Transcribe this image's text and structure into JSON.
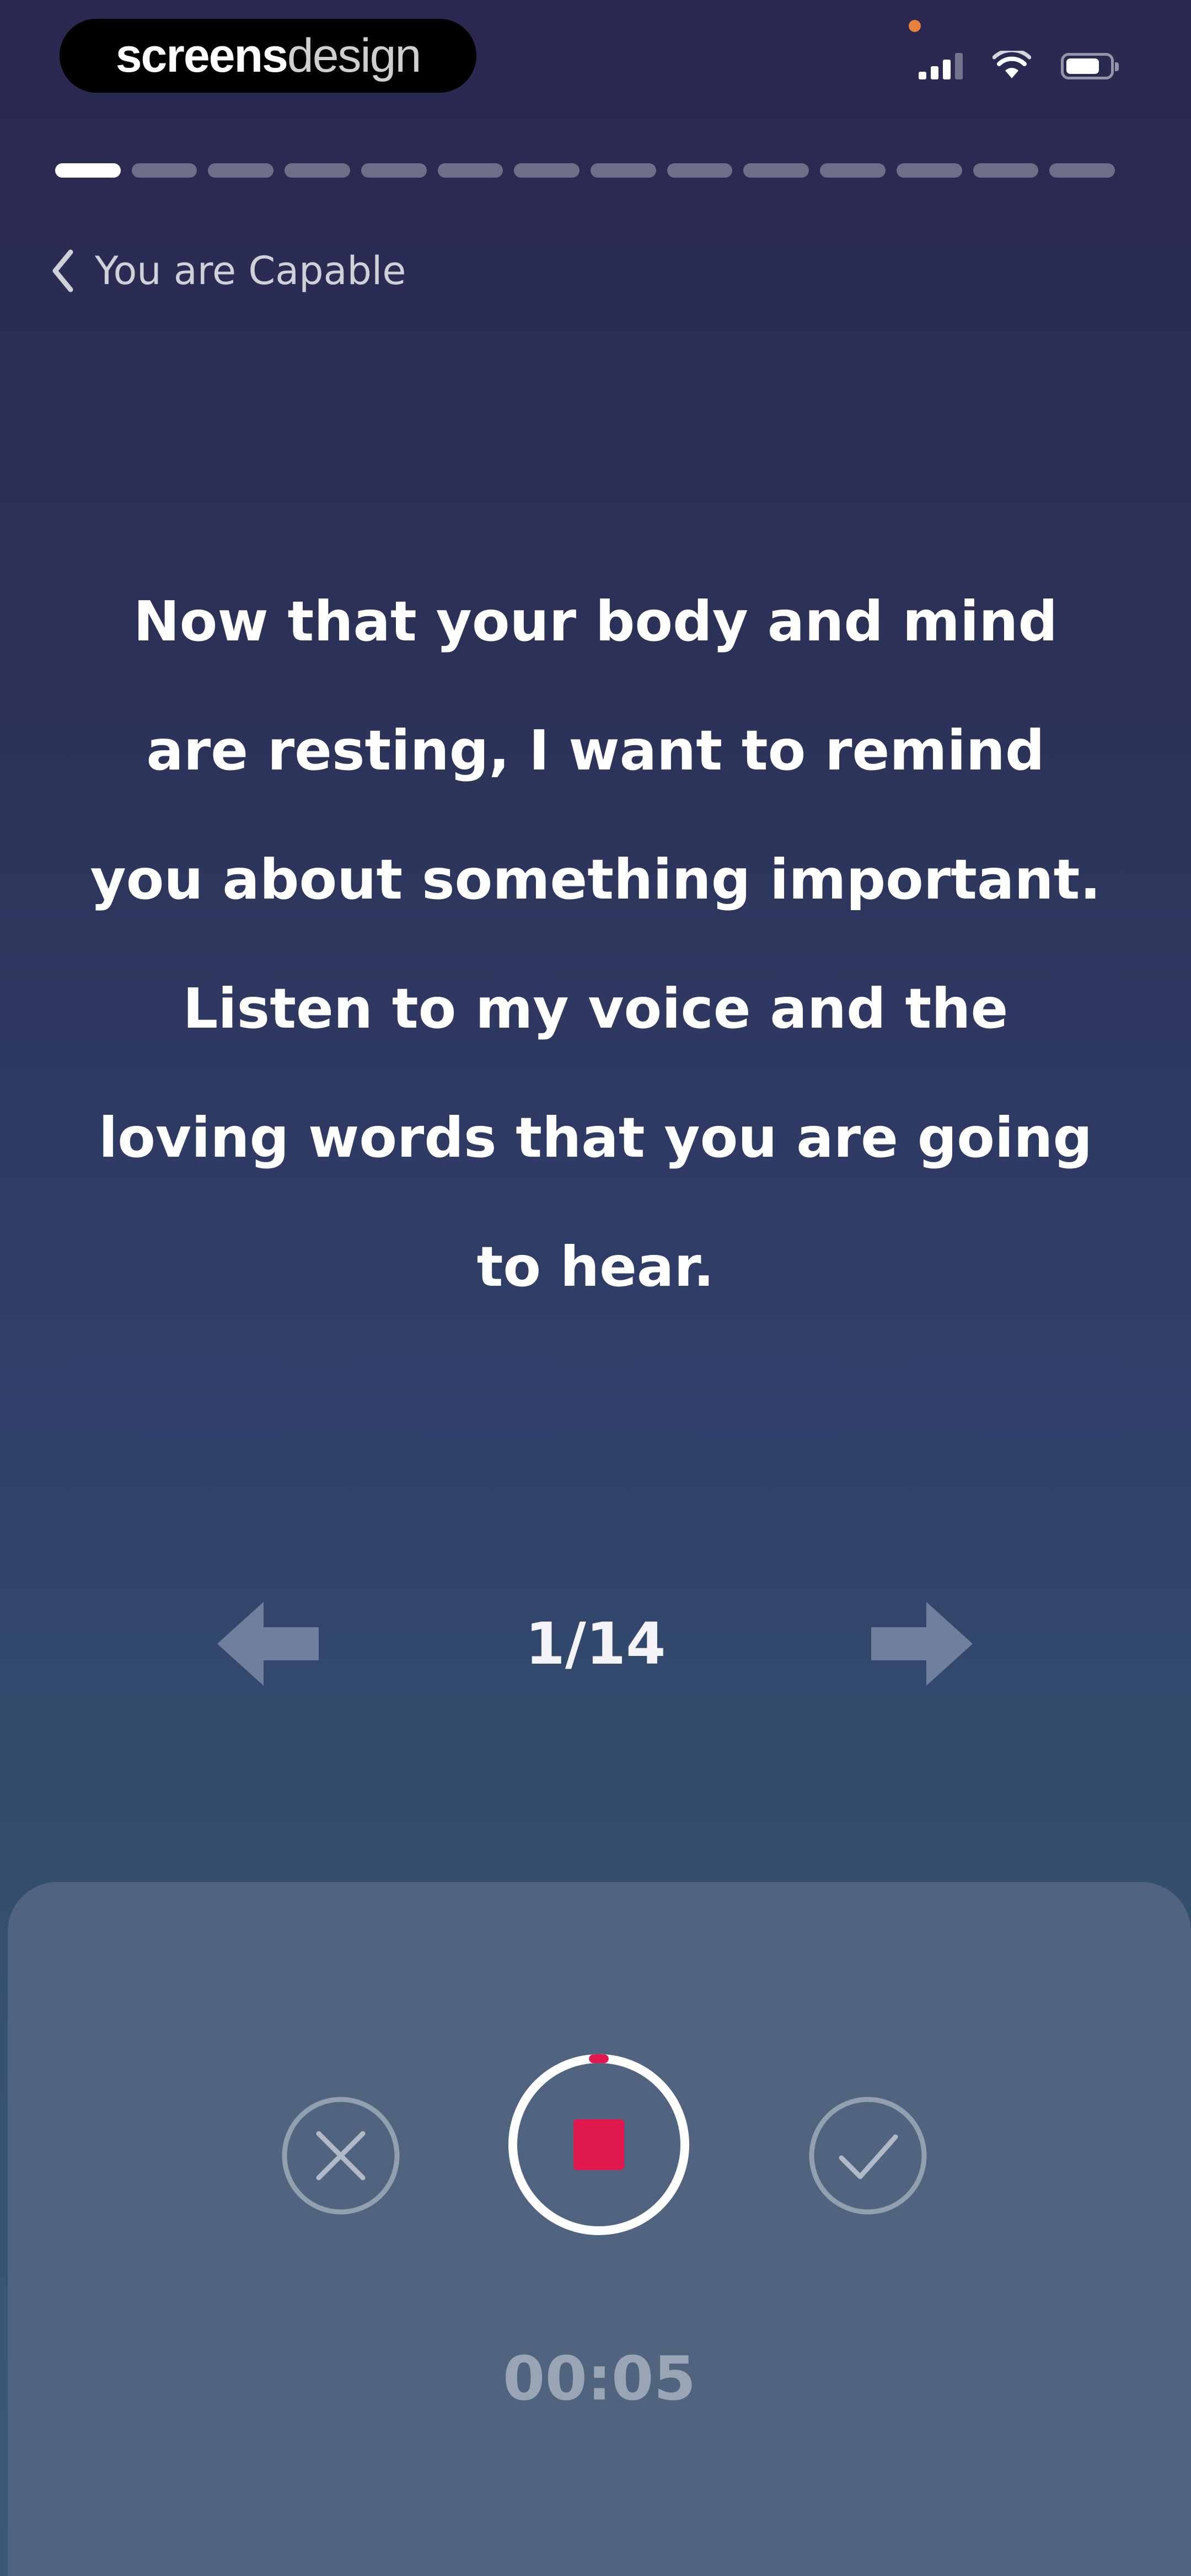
{
  "status_bar": {
    "watermark_part1": "screens",
    "watermark_part2": "design",
    "icons": [
      "signal-icon",
      "wifi-icon",
      "battery-icon"
    ]
  },
  "progress": {
    "total_steps": 14,
    "current_step": 1
  },
  "nav": {
    "back_label": "You are Capable"
  },
  "content": {
    "message": "Now that your body and mind are resting, I want to remind you about something important. Listen to my voice and the loving words that you are going to hear."
  },
  "pager": {
    "counter": "1/14",
    "prev_icon": "arrow-left-icon",
    "next_icon": "arrow-right-icon"
  },
  "recorder": {
    "timer": "00:05",
    "recording_progress": 0.02,
    "cancel_icon": "close-icon",
    "stop_icon": "stop-icon",
    "confirm_icon": "checkmark-icon"
  },
  "colors": {
    "background_top": "#2a2850",
    "background_bottom": "#3a5a78",
    "panel": "#50647f",
    "record_accent": "#e0184e"
  }
}
